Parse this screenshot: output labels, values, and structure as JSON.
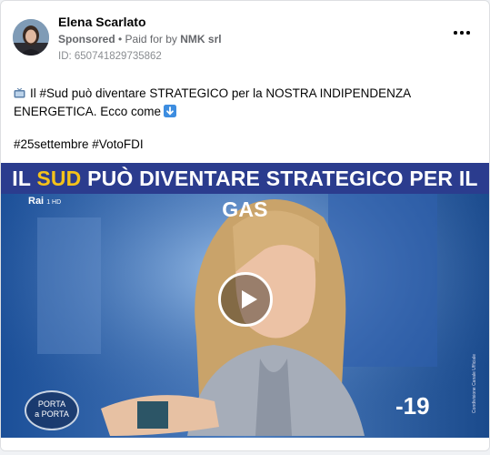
{
  "post": {
    "author": "Elena Scarlato",
    "sponsored_label": "Sponsored",
    "paid_for_prefix": " • Paid for by ",
    "payer": "NMK srl",
    "ad_id": "ID: 650741829735862",
    "text_before_tv": "",
    "text": "Il #Sud può diventare STRATEGICO per la NOSTRA INDIPENDENZA ENERGETICA. Ecco come",
    "hashtags": "#25settembre #VotoFDI"
  },
  "video": {
    "banner_part1": "IL ",
    "banner_highlight": "SUD",
    "banner_part2": " PUÒ DIVENTARE STRATEGICO PER IL GAS",
    "channel_logo": "Rai",
    "channel_hd": "1 HD",
    "show_logo_line1": "PORTA",
    "show_logo_line2": "a PORTA",
    "countdown": "-19",
    "credit": "Condivisione Canale Ufficiale"
  },
  "icons": {
    "more": "more-options-icon",
    "tv": "television-icon",
    "down": "down-arrow-icon",
    "play": "play-icon"
  },
  "colors": {
    "banner_bg": "#2b3c8e",
    "banner_highlight": "#f4c21a"
  }
}
